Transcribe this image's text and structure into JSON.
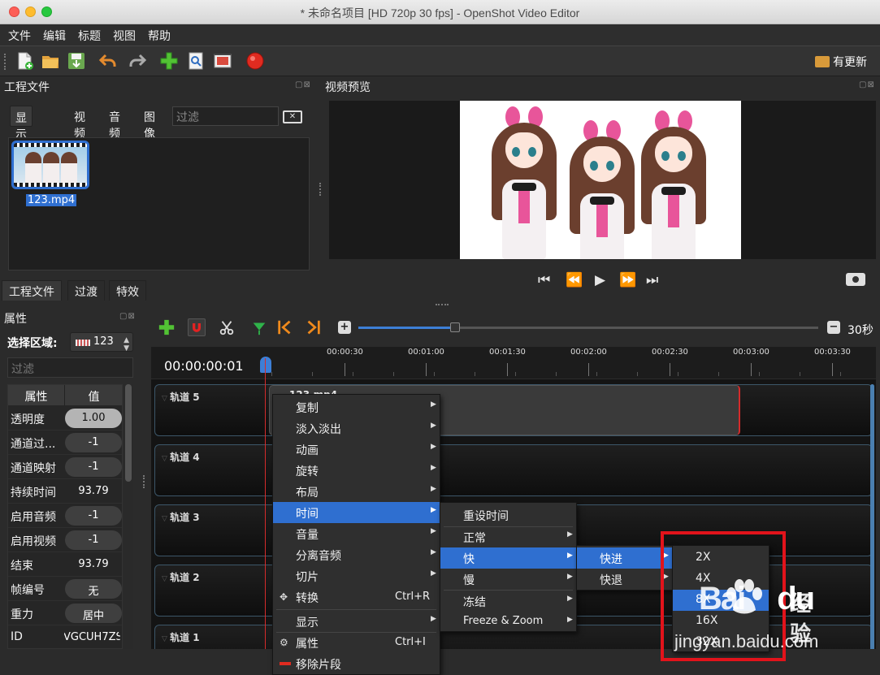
{
  "window": {
    "title": "* 未命名项目 [HD 720p 30 fps] - OpenShot Video Editor"
  },
  "menubar": [
    "文件",
    "编辑",
    "标题",
    "视图",
    "帮助"
  ],
  "toolbar": {
    "update_label": "有更新"
  },
  "project_panel": {
    "title": "工程文件",
    "filters": [
      "显示全部",
      "视频",
      "音频",
      "图像"
    ],
    "filter_placeholder": "过滤",
    "files": [
      {
        "name": "123.mp4"
      }
    ]
  },
  "bottom_tabs": [
    "工程文件",
    "过渡",
    "特效"
  ],
  "preview_panel": {
    "title": "视频预览"
  },
  "properties_panel": {
    "title": "属性",
    "select_label": "选择区域:",
    "select_value": "123",
    "filter_placeholder": "过滤",
    "headers": [
      "属性",
      "值"
    ],
    "rows": [
      {
        "key": "透明度",
        "value": "1.00"
      },
      {
        "key": "通道过...",
        "value": "-1"
      },
      {
        "key": "通道映射",
        "value": "-1"
      },
      {
        "key": "持续时间",
        "value": "93.79"
      },
      {
        "key": "启用音频",
        "value": "-1"
      },
      {
        "key": "启用视频",
        "value": "-1"
      },
      {
        "key": "结束",
        "value": "93.79"
      },
      {
        "key": "帧编号",
        "value": "无"
      },
      {
        "key": "重力",
        "value": "居中"
      },
      {
        "key": "ID",
        "value": "VGCUH7ZS"
      }
    ]
  },
  "timeline": {
    "zoom_label": "30秒",
    "zoom_level": 0.21,
    "timecode": "00:00:00:01",
    "ticks": [
      "00:00:30",
      "00:01:00",
      "00:01:30",
      "00:02:00",
      "00:02:30",
      "00:03:00",
      "00:03:30"
    ],
    "tracks": [
      "轨道 5",
      "轨道 4",
      "轨道 3",
      "轨道 2",
      "轨道 1"
    ],
    "clip_name": "123.mp4"
  },
  "context_menu": {
    "items": [
      {
        "label": "复制",
        "submenu": true
      },
      {
        "label": "淡入淡出",
        "submenu": true
      },
      {
        "label": "动画",
        "submenu": true
      },
      {
        "label": "旋转",
        "submenu": true
      },
      {
        "label": "布局",
        "submenu": true
      },
      {
        "label": "时间",
        "submenu": true,
        "selected": true
      },
      {
        "label": "音量",
        "submenu": true
      },
      {
        "label": "分离音频",
        "submenu": true
      },
      {
        "label": "切片",
        "submenu": true
      },
      {
        "label": "转换",
        "shortcut": "Ctrl+R"
      },
      {
        "label": "显示",
        "submenu": true
      },
      {
        "label": "属性",
        "shortcut": "Ctrl+I"
      },
      {
        "label": "移除片段"
      }
    ],
    "time_submenu": [
      {
        "label": "重设时间"
      },
      {
        "label": "正常",
        "submenu": true
      },
      {
        "label": "快",
        "submenu": true,
        "selected": true
      },
      {
        "label": "慢",
        "submenu": true
      },
      {
        "label": "冻结",
        "submenu": true
      },
      {
        "label": "Freeze & Zoom",
        "submenu": true
      }
    ],
    "fast_submenu": [
      {
        "label": "快进",
        "submenu": true,
        "selected": true
      },
      {
        "label": "快退",
        "submenu": true
      }
    ],
    "speed_submenu": [
      "2X",
      "4X",
      "8X",
      "16X",
      "32X"
    ],
    "speed_selected": "8X"
  },
  "watermark": {
    "logo_a": "Bai",
    "logo_b": "du",
    "sub": "经验",
    "url": "jingyan.baidu.com"
  }
}
